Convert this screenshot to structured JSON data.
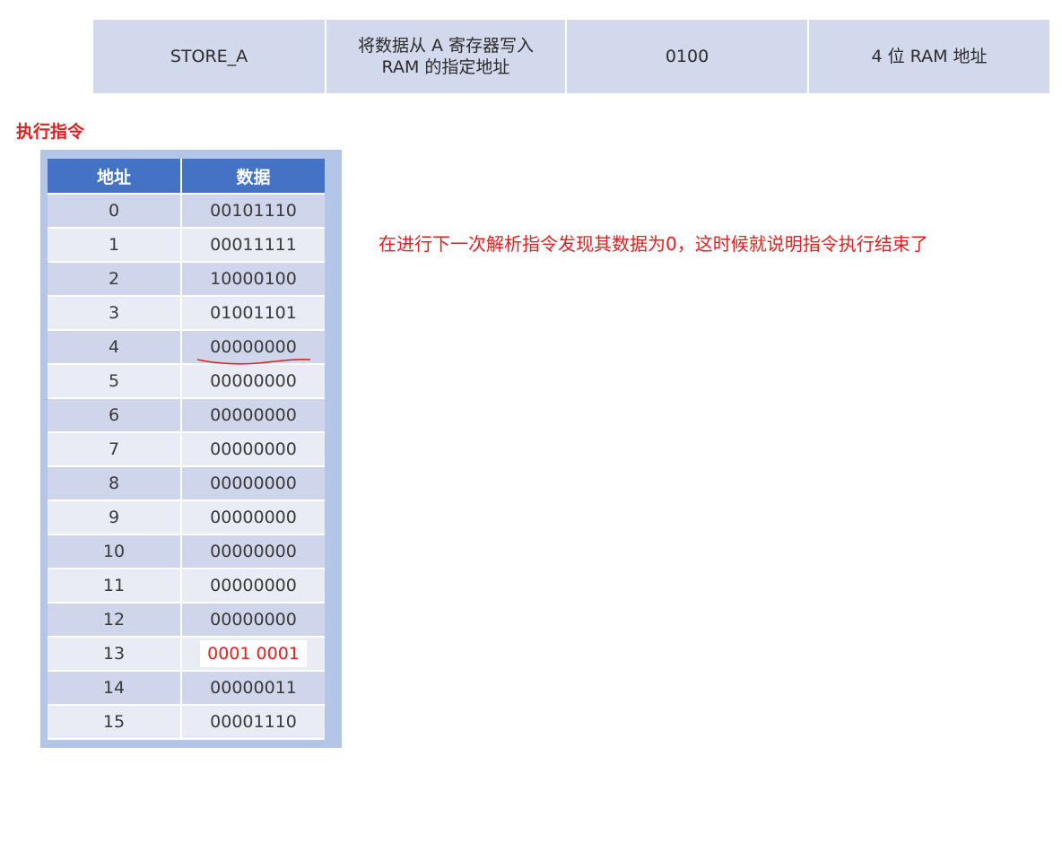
{
  "instruction_row": {
    "mnemonic": "STORE_A",
    "description_line1": "将数据从 A 寄存器写入",
    "description_line2": "RAM 的指定地址",
    "opcode": "0100",
    "operand": "4 位 RAM 地址"
  },
  "section_title": "执行指令",
  "memory_table": {
    "headers": {
      "address": "地址",
      "data": "数据"
    },
    "rows": [
      {
        "address": "0",
        "data": "00101110"
      },
      {
        "address": "1",
        "data": "00011111"
      },
      {
        "address": "2",
        "data": "10000100"
      },
      {
        "address": "3",
        "data": "01001101"
      },
      {
        "address": "4",
        "data": "00000000"
      },
      {
        "address": "5",
        "data": "00000000"
      },
      {
        "address": "6",
        "data": "00000000"
      },
      {
        "address": "7",
        "data": "00000000"
      },
      {
        "address": "8",
        "data": "00000000"
      },
      {
        "address": "9",
        "data": "00000000"
      },
      {
        "address": "10",
        "data": "00000000"
      },
      {
        "address": "11",
        "data": "00000000"
      },
      {
        "address": "12",
        "data": "00000000"
      },
      {
        "address": "13",
        "data": "0001 0001"
      },
      {
        "address": "14",
        "data": "00000011"
      },
      {
        "address": "15",
        "data": "00001110"
      }
    ]
  },
  "note": "在进行下一次解析指令发现其数据为0，这时候就说明指令执行结束了",
  "colors": {
    "header_blue": "#4472c4",
    "frame_blue": "#b4c6e7",
    "row_dark": "#cfd5ea",
    "row_light": "#e9ebf5",
    "annotation_red": "#e02020"
  }
}
